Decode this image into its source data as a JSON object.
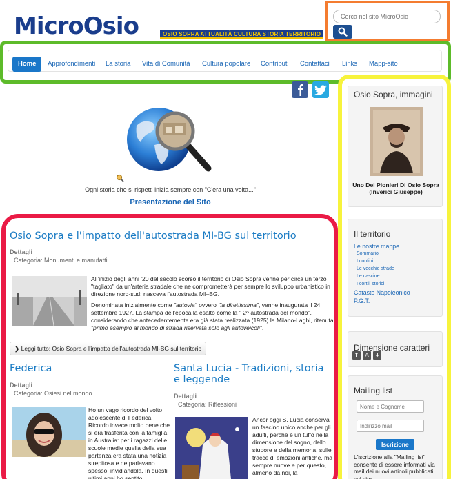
{
  "header": {
    "logo_text": "MicroOsio",
    "logo_tagline": "OSIO SOPRA ATTUALITÀ CULTURA STORIA TERRITORIO",
    "search_placeholder": "Cerca nel sito MicroOsio"
  },
  "nav": {
    "items": [
      {
        "label": "Home"
      },
      {
        "label": "Approfondimenti"
      },
      {
        "label": "La storia"
      },
      {
        "label": "Vita di Comunità"
      },
      {
        "label": "Cultura popolare"
      },
      {
        "label": "Contributi"
      },
      {
        "label": "Contattaci"
      },
      {
        "label": "Links"
      },
      {
        "label": "Mapp-sito"
      }
    ]
  },
  "intro": {
    "quote": "Ogni storia che si rispetti inizia sempre con \"C'era una volta...\"",
    "link": "Presentazione del Sito"
  },
  "featured": {
    "title": "Osio Sopra e l'impatto dell'autostrada MI-BG sul territorio",
    "details_label": "Dettagli",
    "category": "Categoria: Monumenti e manufatti",
    "para1": "All'inizio degli anni '20 del secolo scorso il territorio di Osio Sopra venne per circa un terzo \"tagliato\" da un'arteria stradale che ne comprometterà per sempre lo sviluppo urbanistico in direzione nord-sud: nasceva l'autostrada MI–BG.",
    "para2_a": "Denominata inizialmente come ",
    "para2_b": "\"autovia\"",
    "para2_c": " ovvero ",
    "para2_d": "\"la direttissima\"",
    "para2_e": ", venne inaugurata il 24 settembre 1927. La stampa dell'epoca la esaltò come la \" 2^ autostrada del mondo\", considerando che antecedentemente era già stata realizzata (1925) la Milano-Laghi, ritenuta ",
    "para2_f": "\"primo esempio al mondo di strada riservata solo agli autoveicoli\"",
    "para2_g": ".",
    "readmore": "Leggi tutto: Osio Sopra e l'impatto dell'autostrada MI-BG sul territorio"
  },
  "article_left": {
    "title": "Federica",
    "details_label": "Dettagli",
    "category": "Categoria: Osiesi nel mondo",
    "text": "Ho un vago ricordo del volto adolescente di Federica. Ricordo invece molto bene che si era trasferita con la famiglia in Australia: per i ragazzi delle scuole medie quella della sua partenza era stata una notizia strepitosa e ne parlavano spesso, invidiandola. In questi ultimi anni ho sentito"
  },
  "article_right": {
    "title": "Santa Lucia - Tradizioni, storia e leggende",
    "details_label": "Dettagli",
    "category": "Categoria: Riflessioni",
    "text": "Ancor oggi S. Lucia conserva un fascino unico anche per gli adulti, perché è un tuffo nella dimensione del sogno, dello stupore e della memoria, sulle tracce di emozioni antiche, ma sempre nuove e per questo, almeno da noi, la"
  },
  "sidebar": {
    "images_title": "Osio Sopra, immagini",
    "portrait_caption": "Uno Dei Pionieri Di Osio Sopra (Inverici Giuseppe)",
    "territory_title": "Il territorio",
    "territory_main_link": "Le nostre mappe",
    "territory_sublinks": [
      "Sommario",
      "I confini",
      "Le vecchie strade",
      "Le cascine",
      "I cortili storici"
    ],
    "territory_link2": "Catasto Napoleonico",
    "territory_link3": "P.G.T.",
    "fontsize_title": "Dimensione caratteri",
    "fontsize_buttons": [
      "⬆",
      "A",
      "⬇"
    ],
    "mailing_title": "Mailing list",
    "name_placeholder": "Nome e Cognome",
    "email_placeholder": "Indirizzo mail",
    "subscribe_label": "Iscrizione",
    "mailing_note": "L'iscrizione alla \"Mailing list\" consente di essere informati via mail dei nuovi articoli pubblicati sul sito."
  }
}
